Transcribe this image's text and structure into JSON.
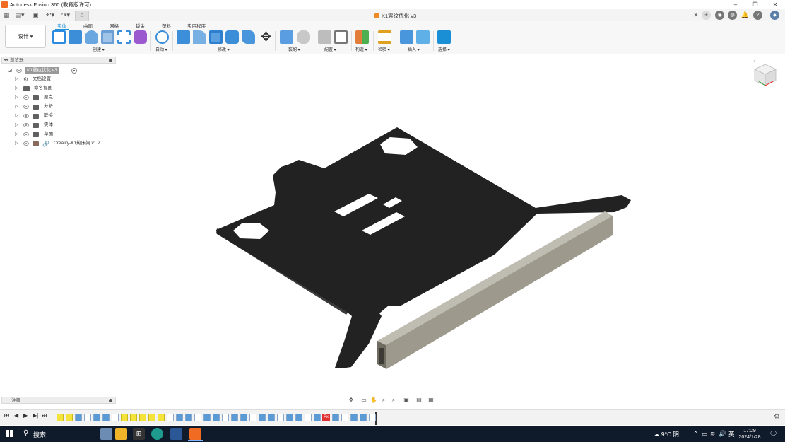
{
  "window": {
    "title": "Autodesk Fusion 360 (教育版许可)",
    "controls": [
      "–",
      "❐",
      "✕"
    ]
  },
  "document": {
    "tab_title": "K1震纹优化 v3"
  },
  "ribbon": {
    "workspace": "设计 ▾",
    "tabs": [
      "实体",
      "曲面",
      "网格",
      "钣金",
      "塑料",
      "实用程序"
    ],
    "active_tab": "实体",
    "groups": [
      "创建 ▾",
      "自动 ▾",
      "修改 ▾",
      "装配 ▾",
      "配置 ▾",
      "构造 ▾",
      "检验 ▾",
      "插入 ▾",
      "选择 ▾"
    ]
  },
  "browser": {
    "title": "浏览器",
    "root": "K1震纹优化 v3",
    "items": [
      "文档设置",
      "命名视图",
      "原点",
      "分析",
      "联接",
      "实体",
      "草图",
      "Creality-K1热床架 v1.2"
    ]
  },
  "notes_panel": {
    "title": "注释"
  },
  "viewcube": {
    "axis_label": "Z"
  },
  "timeline": {
    "error_badge": "Fx"
  },
  "taskbar": {
    "search": "搜索",
    "weather": "9°C 阴",
    "ime": "英",
    "time": "17:29",
    "date": "2024/1/28"
  },
  "colors": {
    "accent": "#1a8fd6",
    "model_plate": "#222222",
    "model_rail": "#9d998c",
    "taskbar": "#0f1a2b",
    "timeline_feature": "#5b9bd5",
    "timeline_highlight": "#f3e33a"
  },
  "icons": {
    "workspace": "grid-icon",
    "ribbon": [
      "sketch-icon",
      "extrude-icon",
      "revolve-icon",
      "hole-icon",
      "pattern-icon",
      "form-icon",
      "automate-icon",
      "press-pull-icon",
      "fillet-icon",
      "shell-icon",
      "combine-icon",
      "align-icon",
      "move-icon",
      "new-component-icon",
      "joint-icon",
      "configure-icon",
      "table-icon",
      "plane-icon",
      "measure-icon",
      "insert-icon",
      "image-icon",
      "select-icon"
    ]
  }
}
